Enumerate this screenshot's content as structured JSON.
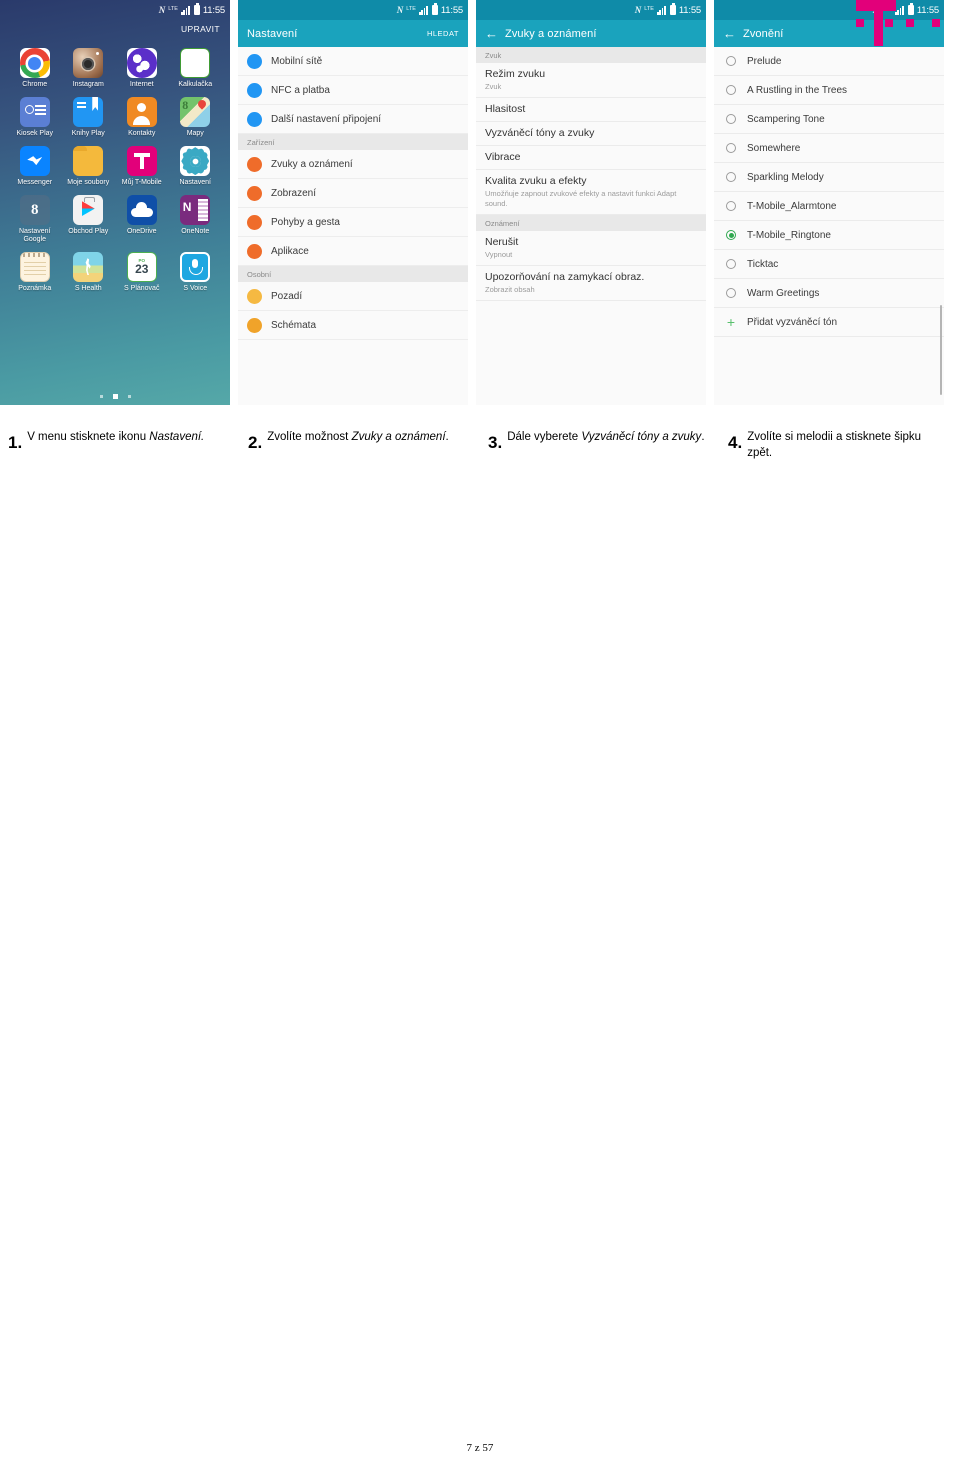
{
  "status_bar": {
    "nfc": "N",
    "lte": "LTE",
    "time": "11:55"
  },
  "panel1": {
    "edit_label": "UPRAVIT",
    "apps": [
      {
        "label": "Chrome",
        "icon": "chrome-icon"
      },
      {
        "label": "Instagram",
        "icon": "instagram-icon"
      },
      {
        "label": "Internet",
        "icon": "internet-icon"
      },
      {
        "label": "Kalkulačka",
        "icon": "calculator-icon"
      },
      {
        "label": "Kiosek Play",
        "icon": "play-newsstand-icon"
      },
      {
        "label": "Knihy Play",
        "icon": "play-books-icon"
      },
      {
        "label": "Kontakty",
        "icon": "contacts-icon"
      },
      {
        "label": "Mapy",
        "icon": "maps-icon"
      },
      {
        "label": "Messenger",
        "icon": "messenger-icon"
      },
      {
        "label": "Moje soubory",
        "icon": "my-files-icon"
      },
      {
        "label": "Můj T-Mobile",
        "icon": "t-mobile-icon"
      },
      {
        "label": "Nastavení",
        "icon": "settings-gear-icon"
      },
      {
        "label": "Nastavení Google",
        "icon": "google-settings-icon"
      },
      {
        "label": "Obchod Play",
        "icon": "play-store-icon"
      },
      {
        "label": "OneDrive",
        "icon": "onedrive-cloud-icon"
      },
      {
        "label": "OneNote",
        "icon": "onenote-icon"
      },
      {
        "label": "Poznámka",
        "icon": "memo-icon"
      },
      {
        "label": "S Health",
        "icon": "s-health-icon"
      },
      {
        "label": "S Plánovač",
        "icon": "s-planner-icon"
      },
      {
        "label": "S Voice",
        "icon": "s-voice-microphone-icon"
      }
    ],
    "calculator_glyphs": [
      "+",
      "−",
      "×",
      "÷"
    ],
    "s_planner": {
      "day_abbr": "PO",
      "day_number": "23"
    },
    "google_settings_glyph": "8"
  },
  "panel2": {
    "title": "Nastavení",
    "search_label": "HLEDAT",
    "items": [
      {
        "type": "item",
        "label": "Mobilní sítě",
        "color": "#2196f3"
      },
      {
        "type": "item",
        "label": "NFC a platba",
        "color": "#2196f3"
      },
      {
        "type": "item",
        "label": "Další nastavení připojení",
        "color": "#2196f3"
      },
      {
        "type": "section",
        "label": "Zařízení"
      },
      {
        "type": "item",
        "label": "Zvuky a oznámení",
        "color": "#ef6c2a"
      },
      {
        "type": "item",
        "label": "Zobrazení",
        "color": "#ef6c2a"
      },
      {
        "type": "item",
        "label": "Pohyby a gesta",
        "color": "#ef6c2a"
      },
      {
        "type": "item",
        "label": "Aplikace",
        "color": "#ef6c2a"
      },
      {
        "type": "section",
        "label": "Osobní"
      },
      {
        "type": "item",
        "label": "Pozadí",
        "color": "#f5b942"
      },
      {
        "type": "item",
        "label": "Schémata",
        "color": "#f0a32a"
      }
    ]
  },
  "panel3": {
    "title": "Zvuky a oznámení",
    "back_icon": "back-arrow-icon",
    "items": [
      {
        "type": "section",
        "label": "Zvuk"
      },
      {
        "type": "item",
        "label": "Režim zvuku",
        "sub": "Zvuk"
      },
      {
        "type": "item",
        "label": "Hlasitost",
        "sub": ""
      },
      {
        "type": "item",
        "label": "Vyzváněcí tóny a zvuky",
        "sub": ""
      },
      {
        "type": "item",
        "label": "Vibrace",
        "sub": ""
      },
      {
        "type": "item",
        "label": "Kvalita zvuku a efekty",
        "sub": "Umožňuje zapnout zvukové efekty a nastavit funkci Adapt sound."
      },
      {
        "type": "section",
        "label": "Oznámení"
      },
      {
        "type": "item",
        "label": "Nerušit",
        "sub": "Vypnout"
      },
      {
        "type": "item",
        "label": "Upozorňování na zamykací obraz.",
        "sub": "Zobrazit obsah"
      }
    ]
  },
  "panel4": {
    "title": "Zvonění",
    "back_icon": "back-arrow-icon",
    "selected": "T-Mobile_Ringtone",
    "ringtones": [
      "Prelude",
      "A Rustling in the Trees",
      "Scampering Tone",
      "Somewhere",
      "Sparkling Melody",
      "T-Mobile_Alarmtone",
      "T-Mobile_Ringtone",
      "Ticktac",
      "Warm Greetings"
    ],
    "add_label": "Přidat vyzváněcí tón",
    "brand_color": "#e2007a"
  },
  "captions": [
    {
      "num": "1.",
      "parts": [
        {
          "text": "V menu stisknete ikonu ",
          "italic": false
        },
        {
          "text": "Nastavení.",
          "italic": true
        }
      ]
    },
    {
      "num": "2.",
      "parts": [
        {
          "text": "Zvolíte možnost ",
          "italic": false
        },
        {
          "text": "Zvuky a oznámení",
          "italic": true
        },
        {
          "text": ".",
          "italic": false
        }
      ]
    },
    {
      "num": "3.",
      "parts": [
        {
          "text": "Dále vyberete ",
          "italic": false
        },
        {
          "text": "Vyzváněcí tóny a zvuky",
          "italic": true
        },
        {
          "text": ".",
          "italic": false
        }
      ]
    },
    {
      "num": "4.",
      "parts": [
        {
          "text": "Zvolíte si melodii a stisknete šipku zpět.",
          "italic": false
        }
      ]
    }
  ],
  "footer": {
    "page_label": "7 z 57"
  }
}
